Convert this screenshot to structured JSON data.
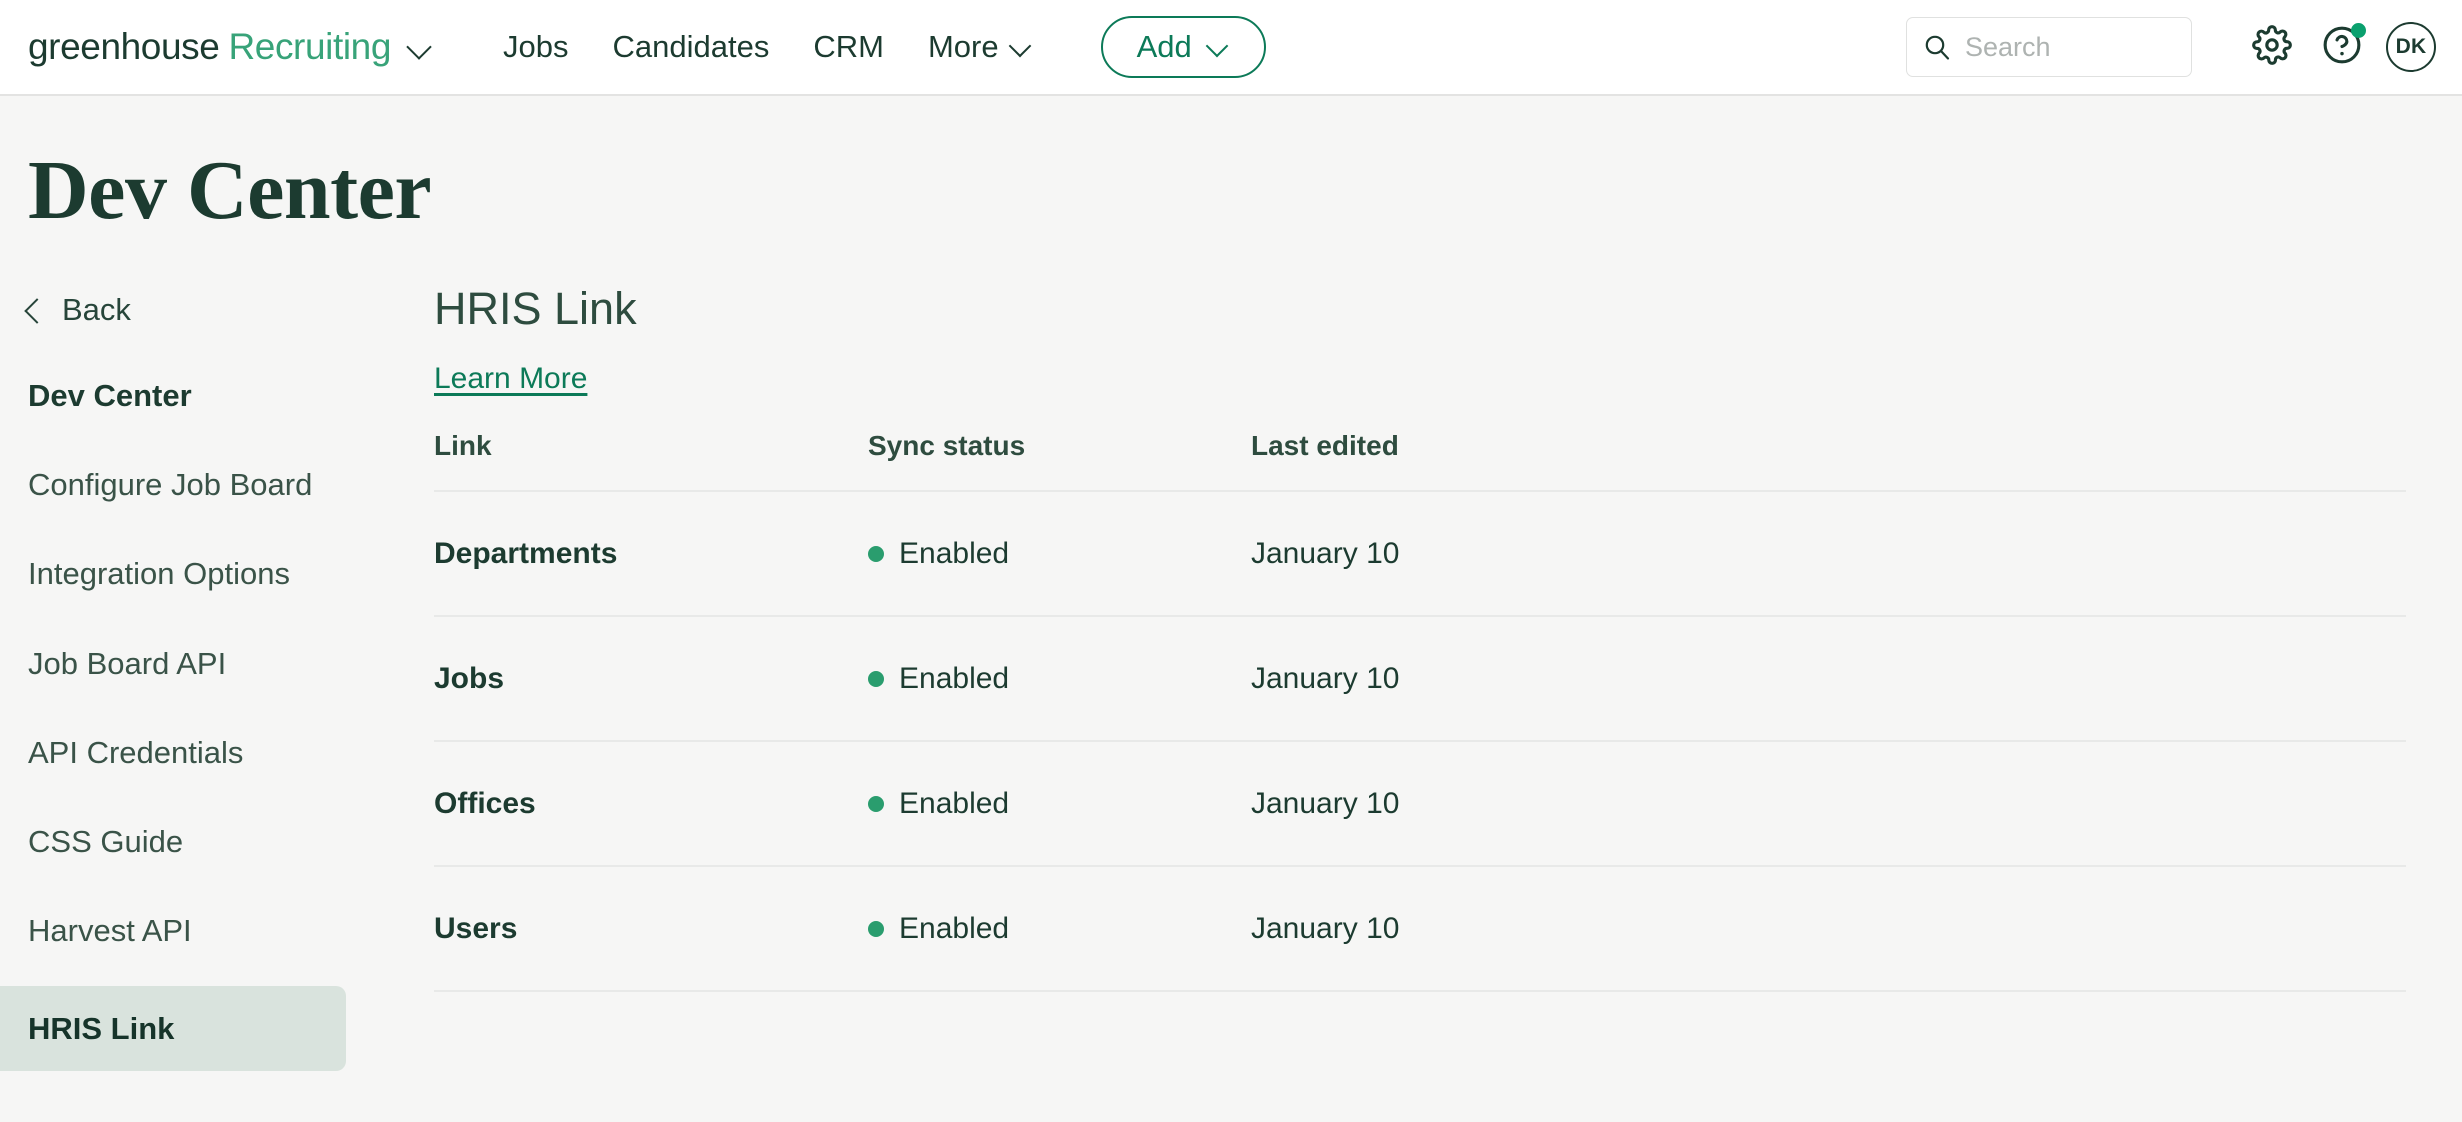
{
  "topnav": {
    "brand_primary": "greenhouse",
    "brand_product": "Recruiting",
    "links": [
      {
        "label": "Jobs",
        "has_caret": false
      },
      {
        "label": "Candidates",
        "has_caret": false
      },
      {
        "label": "CRM",
        "has_caret": false
      },
      {
        "label": "More",
        "has_caret": true
      }
    ],
    "add_button": "Add",
    "search_placeholder": "Search",
    "search_value": "",
    "avatar_initials": "DK",
    "icons": {
      "search": "search-icon",
      "settings": "gear-icon",
      "help": "question-mark-icon",
      "notification": "notification-dot"
    }
  },
  "page": {
    "title": "Dev Center"
  },
  "sidebar": {
    "back_label": "Back",
    "items": [
      {
        "label": "Dev Center",
        "state": "heading"
      },
      {
        "label": "Configure Job Board",
        "state": "normal"
      },
      {
        "label": "Integration Options",
        "state": "normal"
      },
      {
        "label": "Job Board API",
        "state": "normal"
      },
      {
        "label": "API Credentials",
        "state": "normal"
      },
      {
        "label": "CSS Guide",
        "state": "normal"
      },
      {
        "label": "Harvest API",
        "state": "normal"
      },
      {
        "label": "HRIS Link",
        "state": "active"
      }
    ]
  },
  "main": {
    "section_title": "HRIS Link",
    "learn_more": "Learn More",
    "table": {
      "columns": [
        "Link",
        "Sync status",
        "Last edited"
      ],
      "rows": [
        {
          "link": "Departments",
          "sync_status": "Enabled",
          "last_edited": "January 10"
        },
        {
          "link": "Jobs",
          "sync_status": "Enabled",
          "last_edited": "January 10"
        },
        {
          "link": "Offices",
          "sync_status": "Enabled",
          "last_edited": "January 10"
        },
        {
          "link": "Users",
          "sync_status": "Enabled",
          "last_edited": "January 10"
        }
      ]
    }
  },
  "colors": {
    "brand_dark_green": "#1c3b30",
    "brand_green": "#38a379",
    "accent_link": "#0c7a58",
    "status_enabled": "#2a9d6e",
    "sidebar_active_bg": "#d9e3dd",
    "page_bg": "#f6f6f5",
    "divider": "#e8e9e8"
  }
}
